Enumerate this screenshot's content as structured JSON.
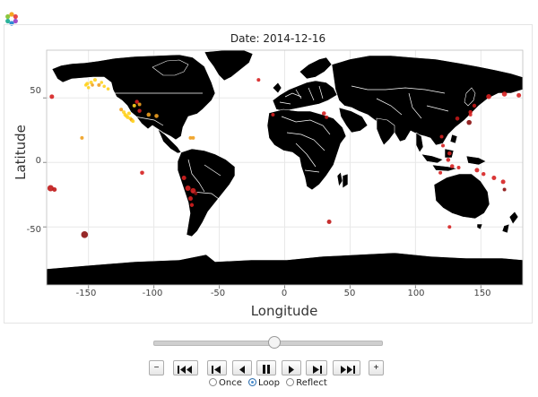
{
  "app": {
    "logo_icon": "bokeh-logo-icon"
  },
  "chart_data": {
    "type": "scatter",
    "title": "Date: 2014-12-16",
    "xlabel": "Longitude",
    "ylabel": "Latitude",
    "xlim": [
      -182,
      182
    ],
    "ylim": [
      -95,
      87
    ],
    "xticks": [
      -150,
      -100,
      -50,
      0,
      50,
      100,
      150
    ],
    "yticks": [
      50,
      0,
      -50
    ],
    "xtick_labels": [
      "-150",
      "-100",
      "-50",
      "0",
      "50",
      "100",
      "150"
    ],
    "ytick_labels": [
      "50",
      "0",
      "-50"
    ],
    "background": "world map (land in black, country borders in white)",
    "grid": true,
    "colors": {
      "land": "#000000",
      "borders": "#ffffff",
      "ocean": "#ffffff",
      "grid": "#e8e8e8"
    },
    "points": [
      {
        "lon": -178,
        "lat": 51,
        "color": "#d62020",
        "r": 2.5
      },
      {
        "lon": -179,
        "lat": -20,
        "color": "#c01818",
        "r": 3.5
      },
      {
        "lon": -176,
        "lat": -21,
        "color": "#c01818",
        "r": 2.5
      },
      {
        "lon": -153,
        "lat": -56,
        "color": "#8b1010",
        "r": 3.8
      },
      {
        "lon": -155,
        "lat": 19,
        "color": "#f0a020",
        "r": 2
      },
      {
        "lon": -151,
        "lat": 61,
        "color": "#ffd21e",
        "r": 2
      },
      {
        "lon": -148,
        "lat": 62,
        "color": "#ffd21e",
        "r": 2
      },
      {
        "lon": -145,
        "lat": 64,
        "color": "#ffd21e",
        "r": 2
      },
      {
        "lon": -142,
        "lat": 60,
        "color": "#f0a020",
        "r": 2
      },
      {
        "lon": -150,
        "lat": 58,
        "color": "#ffd21e",
        "r": 1.8
      },
      {
        "lon": -138,
        "lat": 59,
        "color": "#ffd21e",
        "r": 1.8
      },
      {
        "lon": -135,
        "lat": 57,
        "color": "#ffd21e",
        "r": 1.8
      },
      {
        "lon": -140,
        "lat": 62,
        "color": "#ffd21e",
        "r": 1.8
      },
      {
        "lon": -147,
        "lat": 60,
        "color": "#f0a020",
        "r": 1.8
      },
      {
        "lon": -125,
        "lat": 41,
        "color": "#f0a020",
        "r": 2
      },
      {
        "lon": -123,
        "lat": 39,
        "color": "#ffd21e",
        "r": 2
      },
      {
        "lon": -122,
        "lat": 37,
        "color": "#ffd21e",
        "r": 2
      },
      {
        "lon": -121,
        "lat": 36,
        "color": "#ffd21e",
        "r": 2
      },
      {
        "lon": -120,
        "lat": 35,
        "color": "#ffd21e",
        "r": 2
      },
      {
        "lon": -118,
        "lat": 34,
        "color": "#ffd21e",
        "r": 2
      },
      {
        "lon": -117,
        "lat": 33,
        "color": "#f0a020",
        "r": 2
      },
      {
        "lon": -116,
        "lat": 32,
        "color": "#ffd21e",
        "r": 2
      },
      {
        "lon": -119,
        "lat": 38,
        "color": "#ffd21e",
        "r": 2
      },
      {
        "lon": -115,
        "lat": 44,
        "color": "#ffd21e",
        "r": 2
      },
      {
        "lon": -113,
        "lat": 47,
        "color": "#d62020",
        "r": 2.2
      },
      {
        "lon": -111,
        "lat": 45,
        "color": "#f0a020",
        "r": 2
      },
      {
        "lon": -111,
        "lat": 40,
        "color": "#d62020",
        "r": 2.2
      },
      {
        "lon": -104,
        "lat": 37,
        "color": "#f0a020",
        "r": 2.3
      },
      {
        "lon": -98,
        "lat": 36,
        "color": "#f0a020",
        "r": 2.3
      },
      {
        "lon": -109,
        "lat": -8,
        "color": "#d62020",
        "r": 2.3
      },
      {
        "lon": -72,
        "lat": 19,
        "color": "#f0a020",
        "r": 2
      },
      {
        "lon": -70,
        "lat": 19,
        "color": "#f0a020",
        "r": 2
      },
      {
        "lon": -77,
        "lat": -12,
        "color": "#d62020",
        "r": 2.5
      },
      {
        "lon": -74,
        "lat": -20,
        "color": "#d62020",
        "r": 3
      },
      {
        "lon": -70,
        "lat": -22,
        "color": "#d62020",
        "r": 3
      },
      {
        "lon": -72,
        "lat": -28,
        "color": "#d62020",
        "r": 2.5
      },
      {
        "lon": -68,
        "lat": -24,
        "color": "#8b1010",
        "r": 2
      },
      {
        "lon": -71,
        "lat": -33,
        "color": "#d62020",
        "r": 2.2
      },
      {
        "lon": -9,
        "lat": 37,
        "color": "#d62020",
        "r": 2
      },
      {
        "lon": 30,
        "lat": 38,
        "color": "#d62020",
        "r": 2.3
      },
      {
        "lon": 32,
        "lat": 35,
        "color": "#c01818",
        "r": 2
      },
      {
        "lon": 34,
        "lat": -46,
        "color": "#c01818",
        "r": 2.5
      },
      {
        "lon": -20,
        "lat": 64,
        "color": "#d62020",
        "r": 2
      },
      {
        "lon": 132,
        "lat": 34,
        "color": "#c01818",
        "r": 2.3
      },
      {
        "lon": 142,
        "lat": 39,
        "color": "#d62020",
        "r": 2.2
      },
      {
        "lon": 145,
        "lat": 44,
        "color": "#c01818",
        "r": 2.2
      },
      {
        "lon": 141,
        "lat": 31,
        "color": "#8b1010",
        "r": 2.8
      },
      {
        "lon": 142,
        "lat": 37,
        "color": "#d62020",
        "r": 2
      },
      {
        "lon": 120,
        "lat": 20,
        "color": "#d62020",
        "r": 2
      },
      {
        "lon": 121,
        "lat": 13,
        "color": "#d62020",
        "r": 2
      },
      {
        "lon": 126,
        "lat": 7,
        "color": "#d62020",
        "r": 2.3
      },
      {
        "lon": 125,
        "lat": 2,
        "color": "#d62020",
        "r": 2.3
      },
      {
        "lon": 128,
        "lat": -3,
        "color": "#d62020",
        "r": 2.3
      },
      {
        "lon": 119,
        "lat": -8,
        "color": "#d62020",
        "r": 2
      },
      {
        "lon": 133,
        "lat": -4,
        "color": "#d62020",
        "r": 2
      },
      {
        "lon": 147,
        "lat": -6,
        "color": "#d62020",
        "r": 2.5
      },
      {
        "lon": 152,
        "lat": -9,
        "color": "#d62020",
        "r": 2.2
      },
      {
        "lon": 160,
        "lat": -12,
        "color": "#d62020",
        "r": 2.5
      },
      {
        "lon": 167,
        "lat": -15,
        "color": "#d62020",
        "r": 2.5
      },
      {
        "lon": 168,
        "lat": -21,
        "color": "#8b1010",
        "r": 2
      },
      {
        "lon": 126,
        "lat": -50,
        "color": "#d62020",
        "r": 2
      },
      {
        "lon": 156,
        "lat": 51,
        "color": "#d62020",
        "r": 2.8
      },
      {
        "lon": 168,
        "lat": 53,
        "color": "#d62020",
        "r": 2.8
      },
      {
        "lon": 179,
        "lat": 52,
        "color": "#d62020",
        "r": 2.5
      },
      {
        "lon": -152,
        "lat": 60,
        "color": "#ffd21e",
        "r": 1.8
      }
    ]
  },
  "player": {
    "slider_fraction": 0.53,
    "buttons": {
      "minus": "−",
      "plus": "+",
      "first": "first-frame-icon",
      "prev_step": "step-back-icon",
      "reverse": "play-reverse-icon",
      "pause": "pause-icon",
      "play": "play-icon",
      "next_step": "step-forward-icon",
      "last": "last-frame-icon"
    },
    "loop_options": [
      {
        "label": "Once",
        "selected": false
      },
      {
        "label": "Loop",
        "selected": true
      },
      {
        "label": "Reflect",
        "selected": false
      }
    ]
  }
}
